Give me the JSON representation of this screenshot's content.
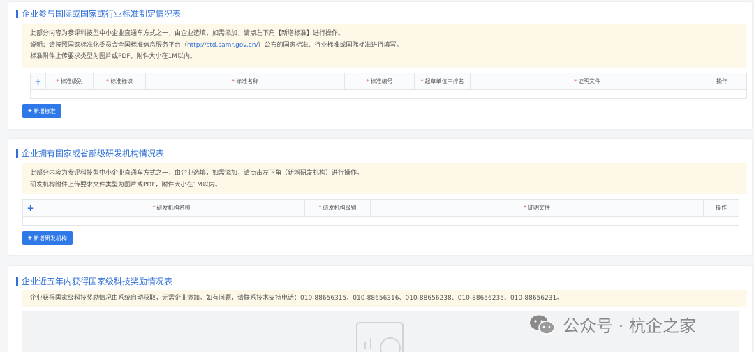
{
  "section_standards": {
    "title": "企业参与国际或国家或行业标准制定情况表",
    "notice_line1": "此部分内容为参评科技型中小企业直通车方式之一，由企业选填，如需添加，请点左下角【新增标准】进行操作。",
    "notice_line2_prefix": "说明：请按照国家标准化委员会全国标准信息服务平台（",
    "notice_line2_link": "http://std.samr.gov.cn/",
    "notice_line2_suffix": "）公布的国家标准、行业标准或国际标准进行填写。",
    "notice_line3": "标准附件上传要求类型为图片或PDF，附件大小在1M以内。",
    "columns": [
      "标准级别",
      "标准标识",
      "标准名称",
      "标准编号",
      "起草单位中排名",
      "证明文件"
    ],
    "action_header": "操作",
    "add_button": "新增标准"
  },
  "section_rnd": {
    "title": "企业拥有国家或省部级研发机构情况表",
    "notice_line1": "此部分内容为参评科技型中小企业直通车方式之一，由企业选填，如需添加，请点击左下角【新增研发机构】进行操作。",
    "notice_line2": "研发机构附件上传要求文件类型为图片或PDF，附件大小在1M以内。",
    "columns": [
      "研发机构名称",
      "研发机构级别",
      "证明文件"
    ],
    "action_header": "操作",
    "add_button": "新增研发机构"
  },
  "section_awards": {
    "title": "企业近五年内获得国家级科技奖励情况表",
    "notice_line1": "企业获得国家级科技奖励情况由系统自动获取，无需企业添加。如有问题，请联系技术支持电话：010-88656315、010-88656316、010-88656238、010-88656235、010-88656231。"
  },
  "watermark": {
    "text": "公众号 · 杭企之家"
  },
  "required_mark": "*",
  "plus_symbol": "+",
  "colors": {
    "accent": "#2f6fd6",
    "button": "#2f78e8",
    "notice_bg": "#fdf8e8",
    "required": "#e2433a"
  }
}
